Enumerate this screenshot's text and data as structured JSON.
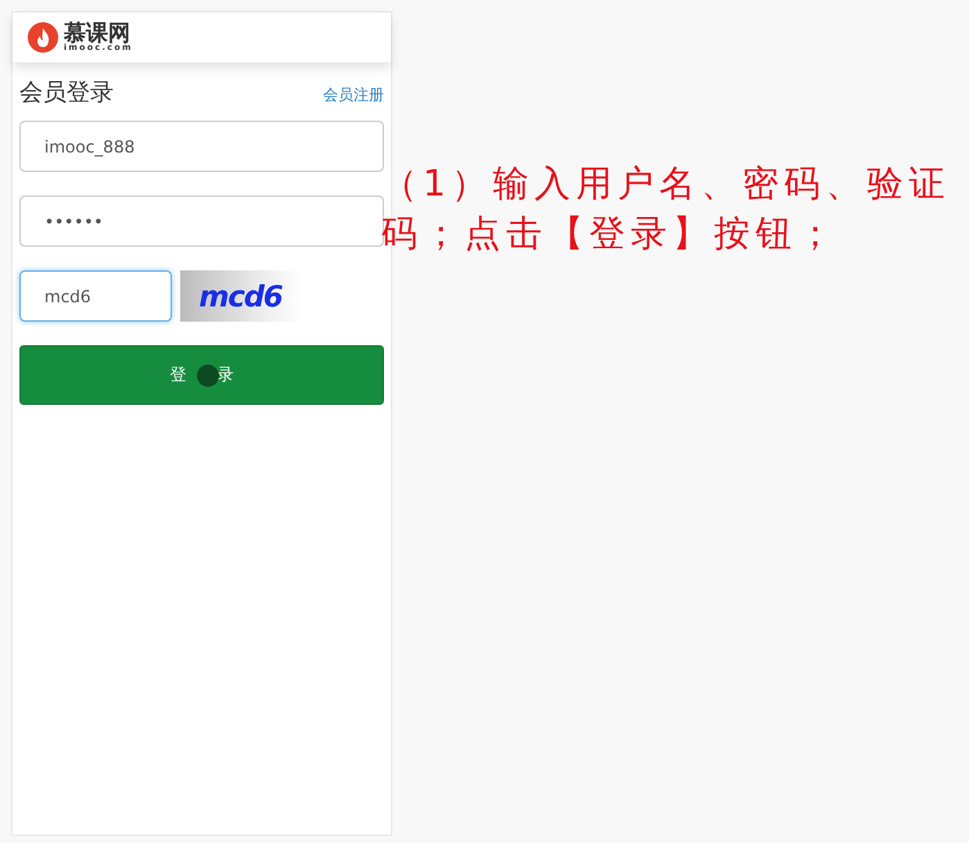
{
  "header": {
    "logo_name": "慕课网",
    "logo_domain": "imooc.com"
  },
  "login": {
    "title": "会员登录",
    "register_link": "会员注册",
    "fields": [
      {
        "kind": "text",
        "value": "imooc_888",
        "focused": false
      },
      {
        "kind": "password",
        "value": "••••••",
        "focused": false
      },
      {
        "kind": "captcha",
        "value": "mcd6",
        "focused": true
      }
    ],
    "captcha_text": "mcd6",
    "button": "登录"
  },
  "annotation": "（1）输入用户名、密码、验证码；点击【登录】按钮；"
}
